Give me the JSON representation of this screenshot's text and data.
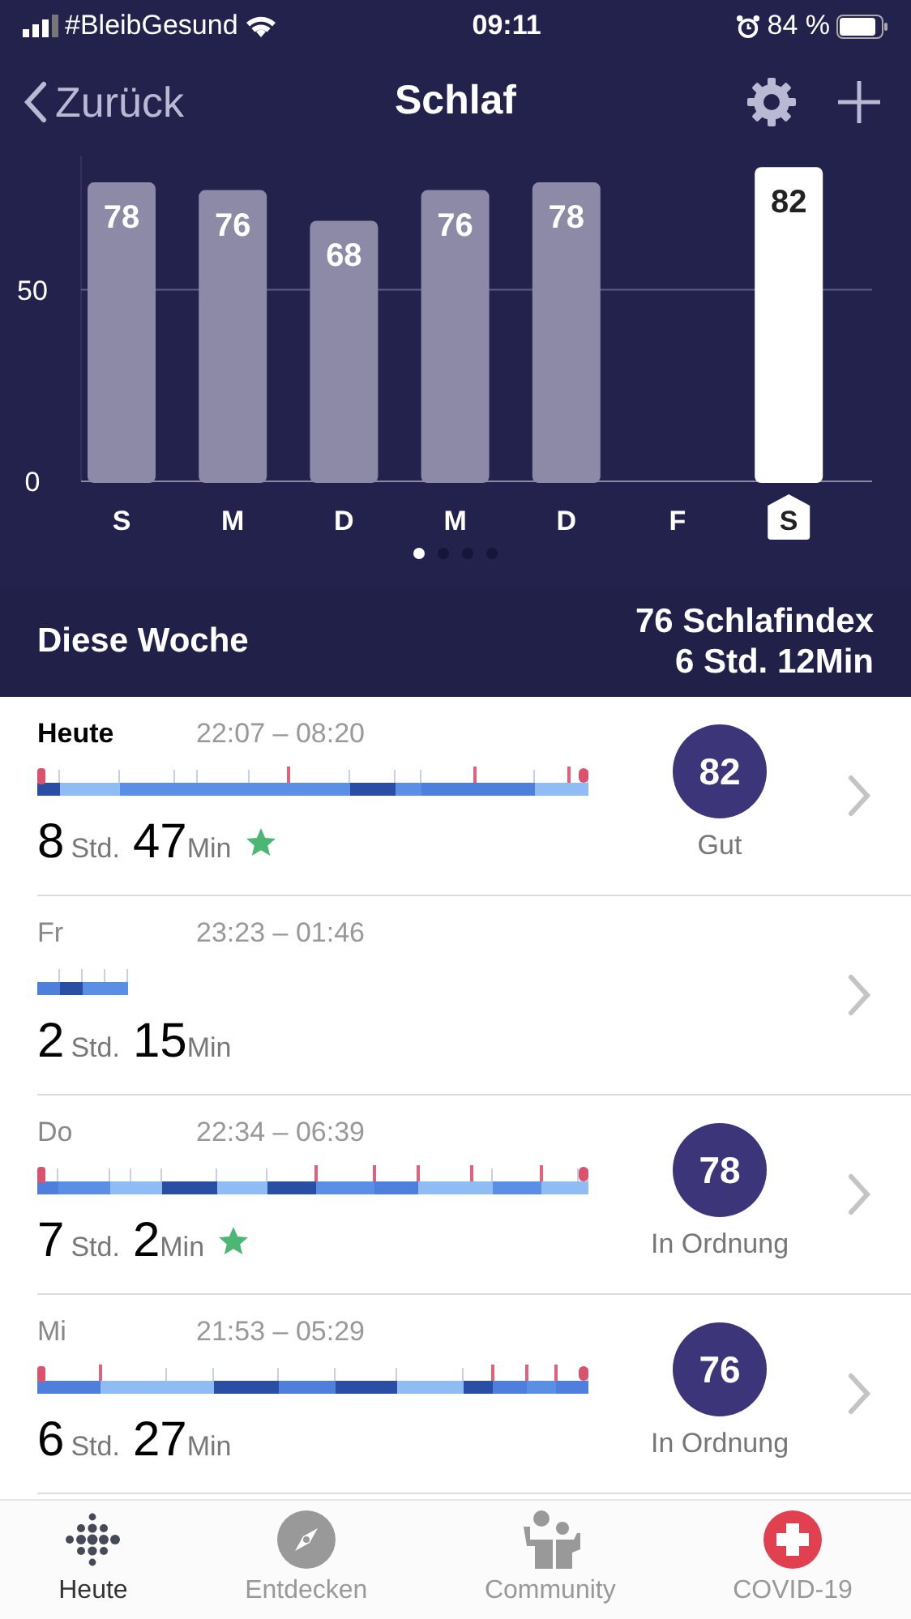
{
  "status_bar": {
    "carrier": "#BleibGesund",
    "time": "09:11",
    "battery": "84 %"
  },
  "nav": {
    "back": "Zurück",
    "title": "Schlaf"
  },
  "chart_data": {
    "type": "bar",
    "categories": [
      "S",
      "M",
      "D",
      "M",
      "D",
      "F",
      "S"
    ],
    "values": [
      78,
      76,
      68,
      76,
      78,
      null,
      82
    ],
    "ylim": [
      0,
      85
    ],
    "yticks": [
      0,
      50
    ],
    "value_labels": [
      "78",
      "76",
      "68",
      "76",
      "78",
      null,
      "82"
    ]
  },
  "day_selection": [
    {
      "selected": false
    },
    {
      "selected": false
    },
    {
      "selected": false
    },
    {
      "selected": false
    },
    {
      "selected": false
    },
    {
      "selected": false
    },
    {
      "selected": true
    }
  ],
  "page_dots": [
    {
      "selected": true
    },
    {
      "selected": false
    },
    {
      "selected": false
    },
    {
      "selected": false
    }
  ],
  "summary": {
    "label": "Diese Woche",
    "score": "76 Schlafindex",
    "duration": "6 Std. 12Min"
  },
  "nights": [
    {
      "day": "Heute",
      "time": "22:07 – 08:20",
      "hours": "8",
      "hours_unit": "Std.",
      "minutes": "47",
      "minutes_unit": "Min",
      "star": true,
      "score": "82",
      "rating": "Gut",
      "kind": "full",
      "emphasis": true
    },
    {
      "day": "Fr",
      "time": "23:23 – 01:46",
      "hours": "2",
      "hours_unit": "Std.",
      "minutes": "15",
      "minutes_unit": "Min",
      "star": false,
      "kind": "short",
      "emphasis": false
    },
    {
      "day": "Do",
      "time": "22:34 – 06:39",
      "hours": "7",
      "hours_unit": "Std.",
      "minutes": "2",
      "minutes_unit": "Min",
      "star": true,
      "score": "78",
      "rating": "In Ordnung",
      "kind": "full",
      "emphasis": false
    },
    {
      "day": "Mi",
      "time": "21:53 – 05:29",
      "hours": "6",
      "hours_unit": "Std.",
      "minutes": "27",
      "minutes_unit": "Min",
      "star": false,
      "score": "76",
      "rating": "In Ordnung",
      "kind": "full",
      "emphasis": false
    }
  ],
  "tabs": [
    {
      "label": "Heute",
      "selected": true
    },
    {
      "label": "Entdecken",
      "selected": false
    },
    {
      "label": "Community",
      "selected": false
    },
    {
      "label": "COVID-19",
      "selected": false
    }
  ]
}
